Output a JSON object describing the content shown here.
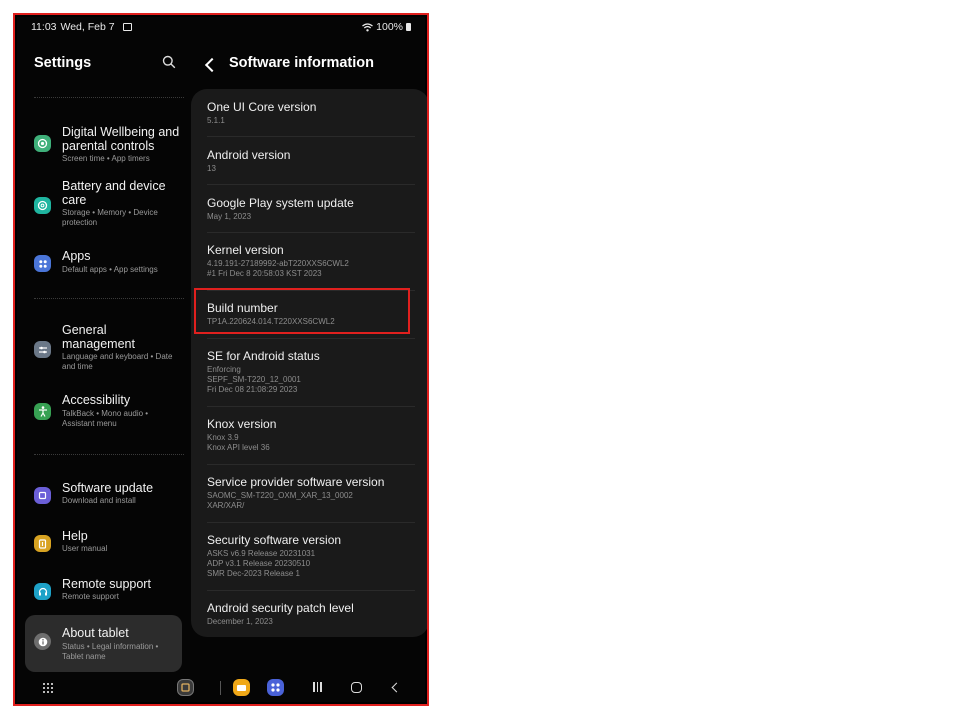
{
  "status_bar": {
    "time": "11:03",
    "date": "Wed, Feb 7",
    "battery": "100%"
  },
  "settings_panel": {
    "title": "Settings",
    "items": [
      {
        "title": "Digital Wellbeing and parental controls",
        "subtitle": "Screen time  •  App timers",
        "icon": "wellbeing-icon",
        "color": "#3fb07a"
      },
      {
        "title": "Battery and device care",
        "subtitle": "Storage  •  Memory  •  Device protection",
        "icon": "device-care-icon",
        "color": "#1fb5a0"
      },
      {
        "title": "Apps",
        "subtitle": "Default apps  •  App settings",
        "icon": "apps-icon",
        "color": "#4a75d8"
      },
      {
        "title": "General management",
        "subtitle": "Language and keyboard  •  Date and time",
        "icon": "general-management-icon",
        "color": "#6b7888"
      },
      {
        "title": "Accessibility",
        "subtitle": "TalkBack  •  Mono audio  •  Assistant menu",
        "icon": "accessibility-icon",
        "color": "#37a153"
      },
      {
        "title": "Software update",
        "subtitle": "Download and install",
        "icon": "software-update-icon",
        "color": "#6b5fd8"
      },
      {
        "title": "Help",
        "subtitle": "User manual",
        "icon": "help-icon",
        "color": "#d8a322"
      },
      {
        "title": "Remote support",
        "subtitle": "Remote support",
        "icon": "remote-support-icon",
        "color": "#1ea2c8"
      },
      {
        "title": "About tablet",
        "subtitle": "Status  •  Legal information  •  Tablet name",
        "icon": "about-icon",
        "color": "#6e6e6e"
      }
    ]
  },
  "software_info": {
    "title": "Software information",
    "rows": [
      {
        "title": "One UI Core version",
        "value": "5.1.1"
      },
      {
        "title": "Android version",
        "value": "13"
      },
      {
        "title": "Google Play system update",
        "value": "May 1, 2023"
      },
      {
        "title": "Kernel version",
        "value": "4.19.191-27189992-abT220XXS6CWL2\n#1 Fri Dec 8 20:58:03 KST 2023"
      },
      {
        "title": "Build number",
        "value": "TP1A.220624.014.T220XXS6CWL2"
      },
      {
        "title": "SE for Android status",
        "value": "Enforcing\nSEPF_SM-T220_12_0001\nFri Dec 08 21:08:29 2023"
      },
      {
        "title": "Knox version",
        "value": "Knox 3.9\nKnox API level 36"
      },
      {
        "title": "Service provider software version",
        "value": "SAOMC_SM-T220_OXM_XAR_13_0002\nXAR/XAR/"
      },
      {
        "title": "Security software version",
        "value": "ASKS v6.9 Release 20231031\nADP v3.1 Release 20230510\nSMR Dec-2023 Release 1"
      },
      {
        "title": "Android security patch level",
        "value": "December 1, 2023"
      }
    ]
  },
  "dock": [
    {
      "icon": "bixby-icon",
      "color": "#3a3a3a"
    },
    {
      "icon": "my-files-icon",
      "color": "#f0a818"
    },
    {
      "icon": "apps-dock-icon",
      "color": "#4a62d8"
    }
  ],
  "colors": {
    "highlight": "#e0201e",
    "background": "#050505",
    "card": "#1a1a1a"
  }
}
